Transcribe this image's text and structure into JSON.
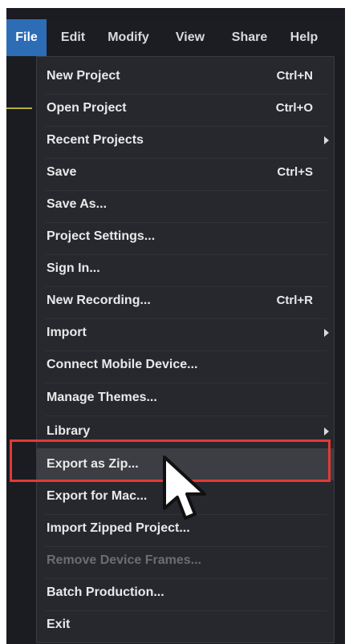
{
  "menubar": {
    "items": [
      {
        "label": "File",
        "active": true
      },
      {
        "label": "Edit",
        "active": false
      },
      {
        "label": "Modify",
        "active": false
      },
      {
        "label": "View",
        "active": false
      },
      {
        "label": "Share",
        "active": false
      },
      {
        "label": "Help",
        "active": false
      }
    ]
  },
  "file_menu": {
    "items": [
      {
        "label": "New Project",
        "shortcut": "Ctrl+N",
        "submenu": false,
        "disabled": false,
        "hovered": false
      },
      {
        "label": "Open Project",
        "shortcut": "Ctrl+O",
        "submenu": false,
        "disabled": false,
        "hovered": false
      },
      {
        "label": "Recent Projects",
        "shortcut": "",
        "submenu": true,
        "disabled": false,
        "hovered": false
      },
      {
        "label": "Save",
        "shortcut": "Ctrl+S",
        "submenu": false,
        "disabled": false,
        "hovered": false
      },
      {
        "label": "Save As...",
        "shortcut": "",
        "submenu": false,
        "disabled": false,
        "hovered": false
      },
      {
        "label": "Project Settings...",
        "shortcut": "",
        "submenu": false,
        "disabled": false,
        "hovered": false
      },
      {
        "label": "Sign In...",
        "shortcut": "",
        "submenu": false,
        "disabled": false,
        "hovered": false
      },
      {
        "label": "New Recording...",
        "shortcut": "Ctrl+R",
        "submenu": false,
        "disabled": false,
        "hovered": false
      },
      {
        "label": "Import",
        "shortcut": "",
        "submenu": true,
        "disabled": false,
        "hovered": false
      },
      {
        "label": "Connect Mobile Device...",
        "shortcut": "",
        "submenu": false,
        "disabled": false,
        "hovered": false
      },
      {
        "label": "Manage Themes...",
        "shortcut": "",
        "submenu": false,
        "disabled": false,
        "hovered": false
      },
      {
        "label": "Library",
        "shortcut": "",
        "submenu": true,
        "disabled": false,
        "hovered": false
      },
      {
        "label": "Export as Zip...",
        "shortcut": "",
        "submenu": false,
        "disabled": false,
        "hovered": true
      },
      {
        "label": "Export for Mac...",
        "shortcut": "",
        "submenu": false,
        "disabled": false,
        "hovered": false
      },
      {
        "label": "Import Zipped Project...",
        "shortcut": "",
        "submenu": false,
        "disabled": false,
        "hovered": false
      },
      {
        "label": "Remove Device Frames...",
        "shortcut": "",
        "submenu": false,
        "disabled": true,
        "hovered": false
      },
      {
        "label": "Batch Production...",
        "shortcut": "",
        "submenu": false,
        "disabled": false,
        "hovered": false
      },
      {
        "label": "Exit",
        "shortcut": "",
        "submenu": false,
        "disabled": false,
        "hovered": false
      }
    ]
  },
  "annotation": {
    "highlight_color": "#e53935",
    "highlighted_item": "Export as Zip..."
  },
  "colors": {
    "active_menu": "#2d6db6",
    "menu_background": "#26282d",
    "hover_row": "#3c3e44",
    "disabled_text": "#6b6d72"
  }
}
